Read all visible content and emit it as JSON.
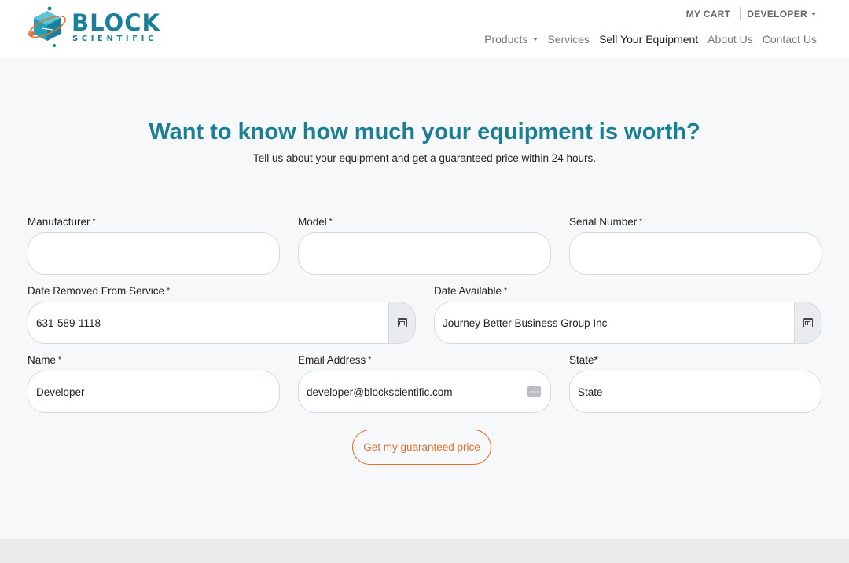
{
  "header": {
    "logo": {
      "name": "BLOCK",
      "tagline": "SCIENTIFIC"
    },
    "topbar": {
      "cart": "MY CART",
      "user": "DEVELOPER"
    },
    "nav": [
      {
        "label": "Products",
        "has_dropdown": true
      },
      {
        "label": "Services"
      },
      {
        "label": "Sell Your Equipment",
        "active": true
      },
      {
        "label": "About Us"
      },
      {
        "label": "Contact Us"
      }
    ]
  },
  "hero": {
    "title": "Want to know how much your equipment is worth?",
    "subtitle": "Tell us about your equipment and get a guaranteed price within 24 hours."
  },
  "form": {
    "required_mark": "*",
    "manufacturer": {
      "label": "Manufacturer",
      "value": ""
    },
    "model": {
      "label": "Model",
      "value": ""
    },
    "serial": {
      "label": "Serial Number",
      "value": ""
    },
    "date_removed": {
      "label": "Date Removed From Service",
      "value": "631-589-1118"
    },
    "date_available": {
      "label": "Date Available",
      "value": "Journey Better Business Group Inc"
    },
    "name": {
      "label": "Name",
      "value": "Developer"
    },
    "email": {
      "label": "Email Address",
      "value": "developer@blockscientific.com"
    },
    "state": {
      "label": "State*",
      "value": "State"
    },
    "submit_label": "Get my guaranteed price"
  },
  "colors": {
    "brand": "#1a7f9a",
    "title": "#1b7f94",
    "accent": "#e2702f",
    "background": "#f7f8fa"
  },
  "icons": [
    "logo-cube-icon",
    "calendar-icon",
    "autofill-icon",
    "caret-down-icon"
  ]
}
